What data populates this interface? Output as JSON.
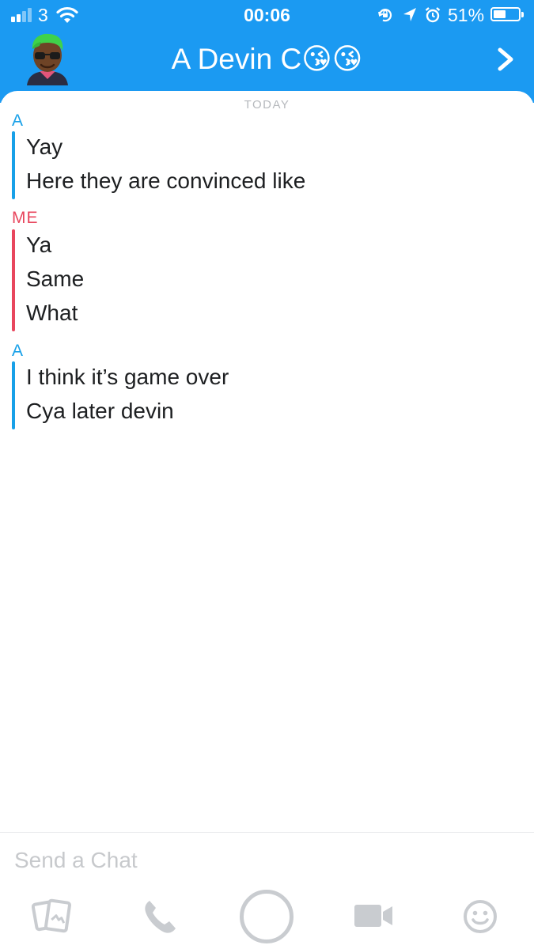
{
  "status_bar": {
    "carrier": "3",
    "time": "00:06",
    "battery": "51%",
    "battery_level": 0.51,
    "icons": [
      "signal-icon",
      "wifi-icon",
      "orientation-lock-icon",
      "location-icon",
      "alarm-icon",
      "battery-icon"
    ]
  },
  "header": {
    "contact_name": "A Devin C😘😘",
    "avatar": "bitmoji-avatar",
    "forward_icon": "chevron-right-icon"
  },
  "chat": {
    "day_label": "TODAY",
    "groups": [
      {
        "sender": "A",
        "color": "#17a0e8",
        "messages": [
          "Yay",
          "Here they are convinced like"
        ]
      },
      {
        "sender": "ME",
        "color": "#e8465d",
        "messages": [
          "Ya",
          "Same",
          "What"
        ]
      },
      {
        "sender": "A",
        "color": "#17a0e8",
        "messages": [
          "I think it’s game over",
          "Cya later devin"
        ]
      }
    ]
  },
  "composer": {
    "placeholder": "Send a Chat"
  },
  "toolbar": {
    "icons": [
      "photo-cards-icon",
      "phone-icon",
      "capture-button",
      "video-camera-icon",
      "smiley-icon"
    ]
  },
  "colors": {
    "header_blue": "#1b9af2",
    "friend_blue": "#17a0e8",
    "me_red": "#e8465d",
    "icon_gray": "#c9ccd0"
  }
}
